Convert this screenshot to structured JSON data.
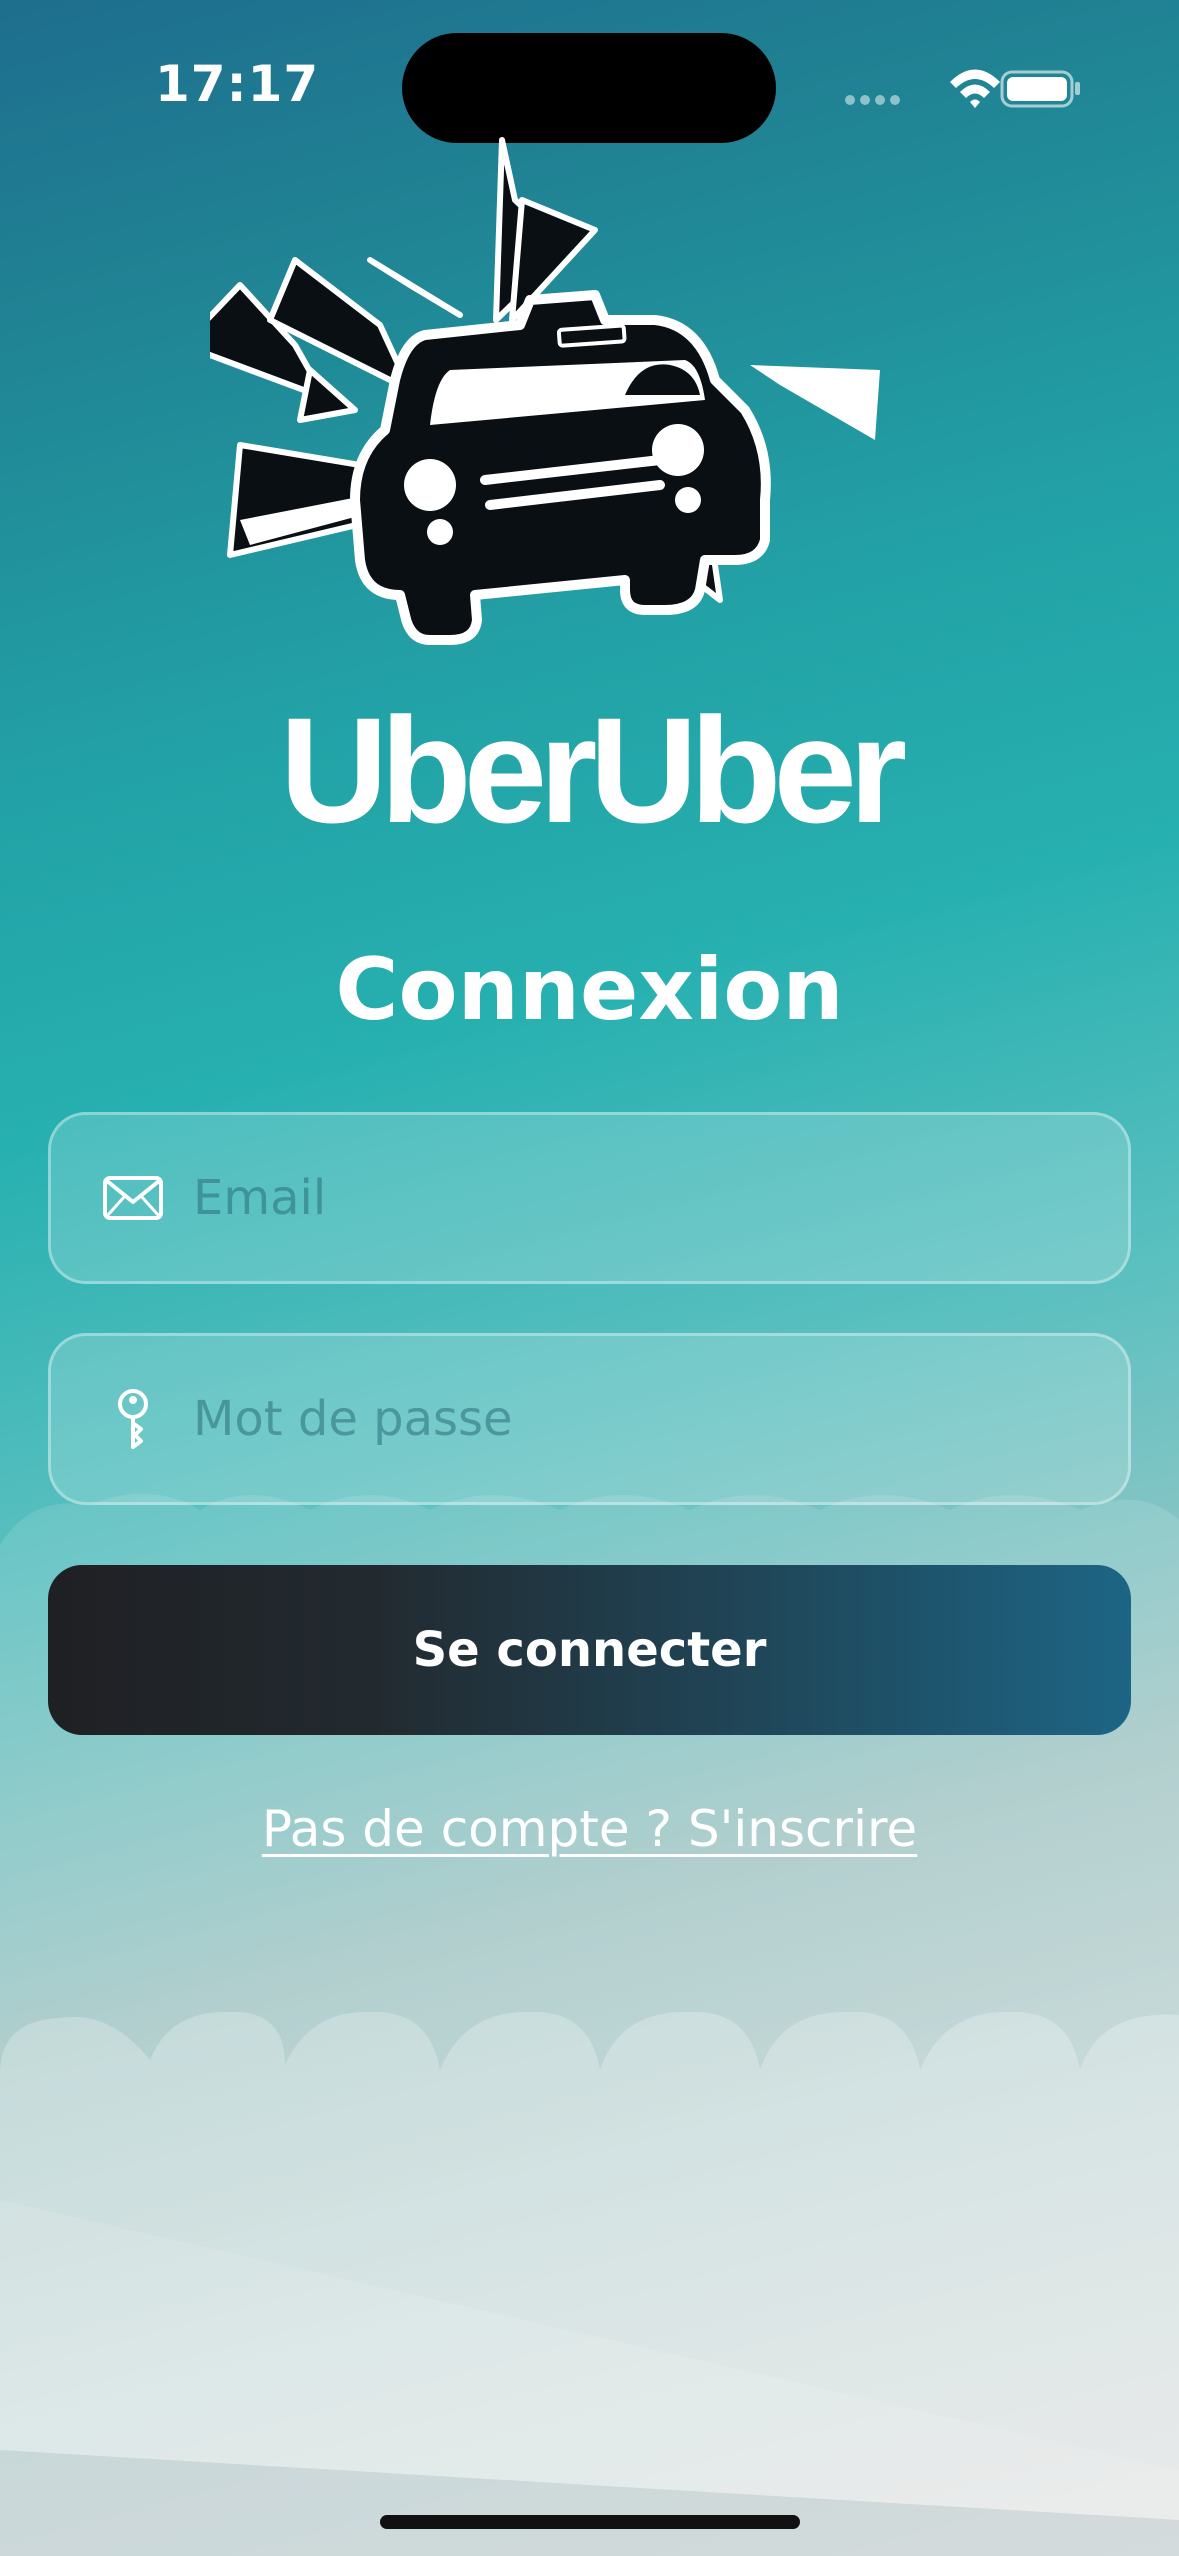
{
  "status_bar": {
    "time": "17:17"
  },
  "brand": {
    "name": "UberUber",
    "logo_icon": "taxi-crash-icon"
  },
  "page": {
    "title": "Connexion"
  },
  "form": {
    "email": {
      "placeholder": "Email",
      "value": "",
      "icon": "envelope-icon"
    },
    "password": {
      "placeholder": "Mot de passe",
      "value": "",
      "icon": "key-icon"
    },
    "submit_label": "Se connecter",
    "signup_link": "Pas de compte ? S'inscrire"
  },
  "colors": {
    "background_top": "#1e6e8e",
    "background_mid": "#27b0b0",
    "background_bottom": "#e0e0e0",
    "button_start": "#1f2024",
    "button_end": "#1d6585"
  }
}
